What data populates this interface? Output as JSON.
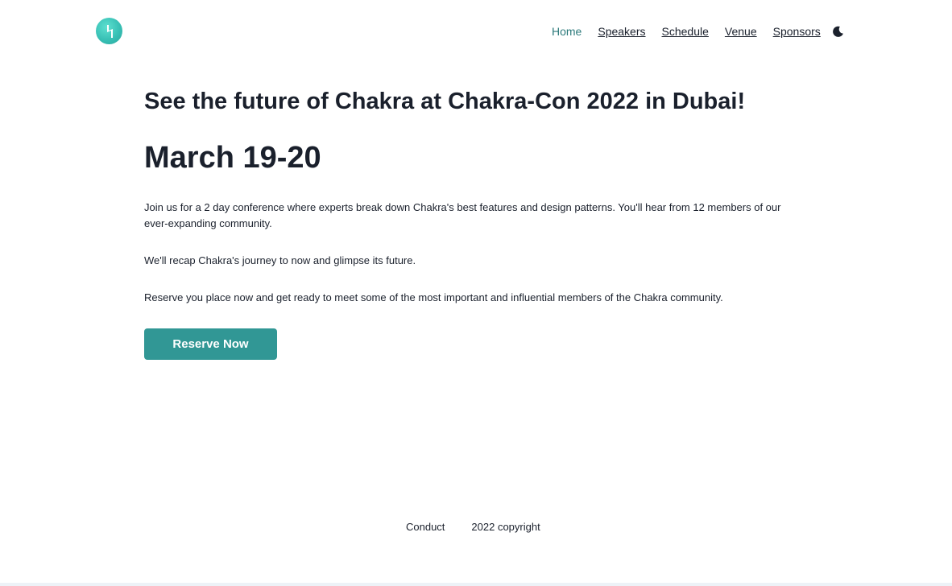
{
  "header": {
    "logo_icon": "chakra-logo-icon",
    "nav": {
      "home": "Home",
      "speakers": "Speakers",
      "schedule": "Schedule",
      "venue": "Venue",
      "sponsors": "Sponsors"
    },
    "active_nav": "Home",
    "theme_toggle_icon": "moon-icon"
  },
  "main": {
    "headline": "See the future of Chakra at Chakra-Con 2022 in Dubai!",
    "date": "March 19-20",
    "paragraphs": [
      "Join us for a 2 day conference where experts break down Chakra's best features and design patterns. You'll hear from 12 members of our ever-expanding community.",
      "We'll recap Chakra's journey to now and glimpse its future.",
      "Reserve you place now and get ready to meet some of the most important and influential members of the Chakra community."
    ],
    "cta_label": "Reserve Now"
  },
  "footer": {
    "conduct": "Conduct",
    "copyright": "2022 copyright"
  },
  "colors": {
    "accent": "#319795",
    "active_link": "#2c7a7b",
    "text": "#1a202c",
    "logo": "#38c0b5"
  }
}
